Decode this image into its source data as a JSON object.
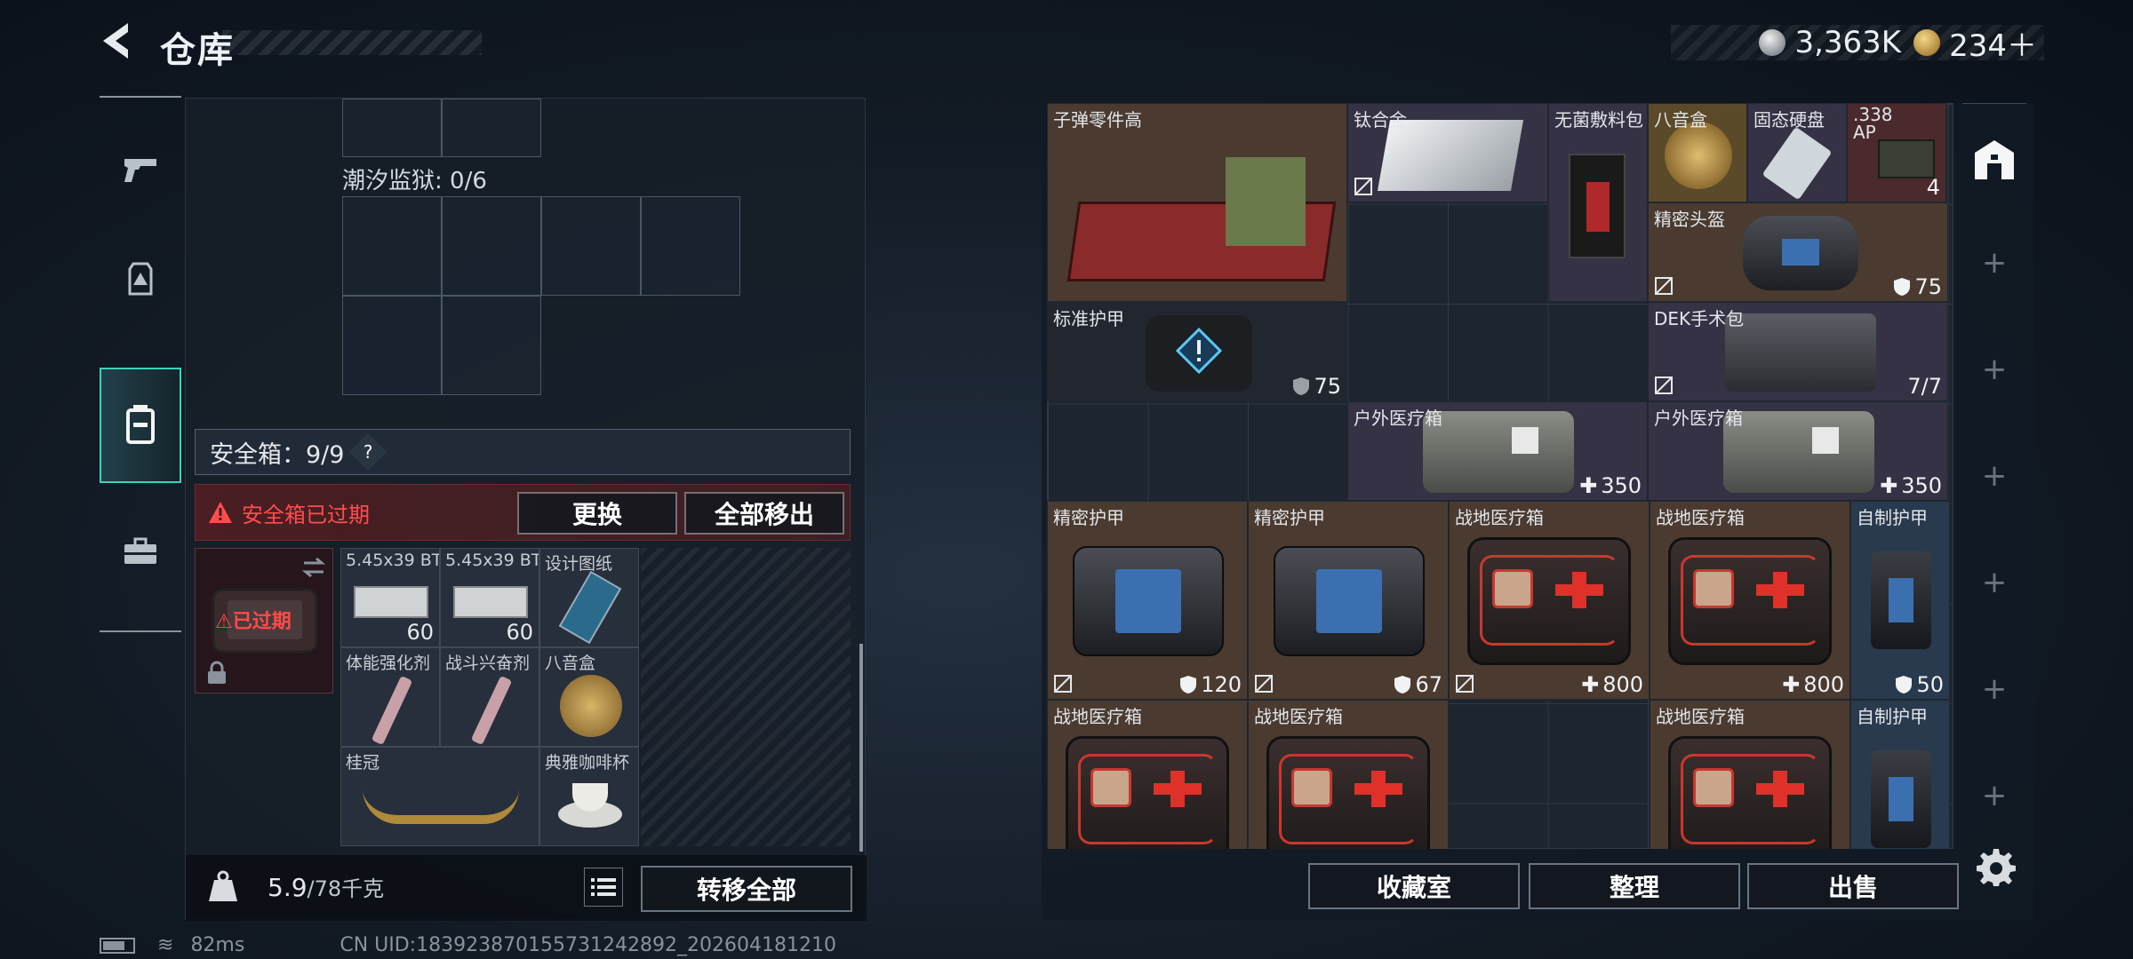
{
  "header": {
    "title": "仓库",
    "currency": [
      {
        "icon": "silver-coin-icon",
        "value": "3,363K"
      },
      {
        "icon": "gold-coin-icon",
        "value": "234＋"
      }
    ]
  },
  "left_tabs": [
    {
      "name": "weapons",
      "icon": "pistol-icon"
    },
    {
      "name": "armor",
      "icon": "backpack-icon"
    },
    {
      "name": "safe-box",
      "icon": "safe-box-icon",
      "active": true
    },
    {
      "name": "tools",
      "icon": "toolbox-icon"
    }
  ],
  "safe_area": {
    "prison_label": "潮汐监狱: 0/6",
    "safe_box_label": "安全箱：9/9",
    "help": "?",
    "expired_warning": "安全箱已过期",
    "replace_button": "更换",
    "move_all_out_button": "全部移出",
    "expired_badge": "已过期",
    "items": [
      {
        "name": "5.45x39 BT",
        "count": "60"
      },
      {
        "name": "5.45x39 BT",
        "count": "60"
      },
      {
        "name": "设计图纸",
        "count": ""
      },
      {
        "name": "体能强化剂",
        "count": ""
      },
      {
        "name": "战斗兴奋剂",
        "count": ""
      },
      {
        "name": "八音盒",
        "count": ""
      },
      {
        "name": "桂冠",
        "count": ""
      },
      {
        "name": "典雅咖啡杯",
        "count": ""
      }
    ],
    "weight": "5.9",
    "weight_max": "/78千克",
    "transfer_all_button": "转移全部"
  },
  "inventory": {
    "items": [
      {
        "name": "子弹零件高",
        "value": ""
      },
      {
        "name": "钛合金",
        "value": ""
      },
      {
        "name": "无菌敷料包",
        "value": ""
      },
      {
        "name": "八音盒",
        "value": ""
      },
      {
        "name": "固态硬盘",
        "value": ""
      },
      {
        "name": ".338 AP",
        "value": "4"
      },
      {
        "name": "精密头盔",
        "value": "75"
      },
      {
        "name": "标准护甲",
        "value": "75"
      },
      {
        "name": "DEK手术包",
        "value": "7/7"
      },
      {
        "name": "户外医疗箱",
        "value": "350"
      },
      {
        "name": "户外医疗箱",
        "value": "350"
      },
      {
        "name": "精密护甲",
        "value": "120"
      },
      {
        "name": "精密护甲",
        "value": "67"
      },
      {
        "name": "战地医疗箱",
        "value": "800"
      },
      {
        "name": "战地医疗箱",
        "value": "800"
      },
      {
        "name": "自制护甲",
        "value": "50"
      },
      {
        "name": "战地医疗箱",
        "value": ""
      },
      {
        "name": "战地医疗箱",
        "value": ""
      },
      {
        "name": "战地医疗箱",
        "value": ""
      },
      {
        "name": "自制护甲",
        "value": ""
      }
    ],
    "collection_button": "收藏室",
    "organize_button": "整理",
    "sell_button": "出售"
  },
  "status": {
    "ping": "82ms",
    "uid": "CN UID:1839238701557312428​92_202604181210"
  },
  "colors": {
    "accent": "#3fd2b8",
    "warning": "#ff4d4d"
  }
}
